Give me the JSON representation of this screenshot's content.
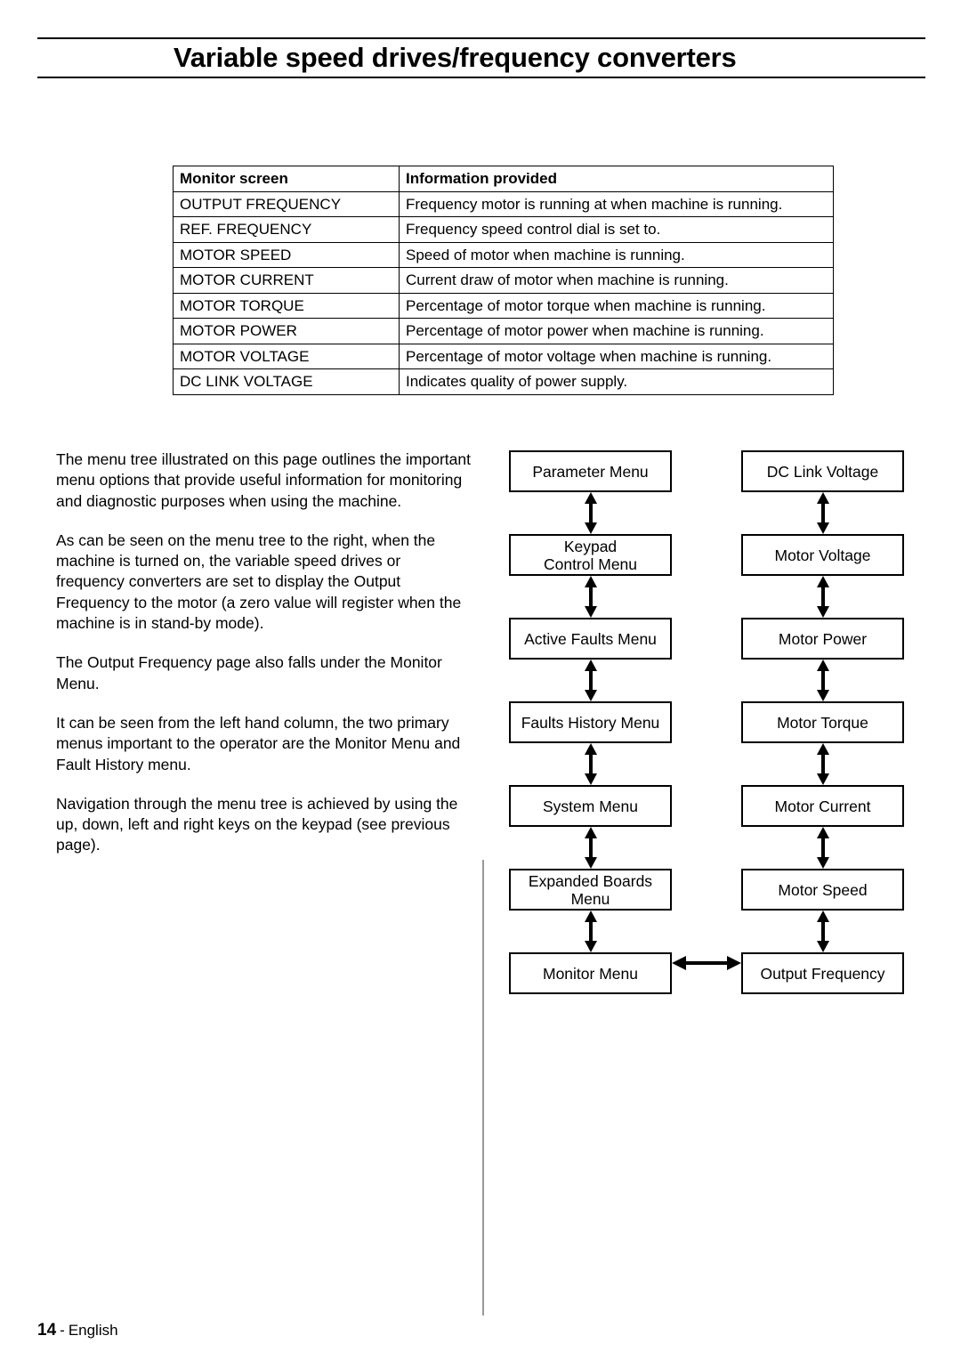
{
  "header": {
    "title": "Variable speed drives/frequency converters"
  },
  "table": {
    "columns": [
      "Monitor screen",
      "Information provided"
    ],
    "rows": [
      [
        "OUTPUT FREQUENCY",
        "Frequency motor is running at when machine is running."
      ],
      [
        "REF. FREQUENCY",
        "Frequency speed control dial is set to."
      ],
      [
        "MOTOR SPEED",
        "Speed of motor when machine is running."
      ],
      [
        "MOTOR CURRENT",
        "Current draw of motor when machine is running."
      ],
      [
        "MOTOR TORQUE",
        "Percentage of motor torque when machine is running."
      ],
      [
        "MOTOR POWER",
        "Percentage of motor power when machine is running."
      ],
      [
        "MOTOR VOLTAGE",
        "Percentage of motor voltage when machine is running."
      ],
      [
        "DC LINK VOLTAGE",
        "Indicates quality of power supply."
      ]
    ]
  },
  "body": {
    "paragraphs": [
      "The menu tree illustrated on this page outlines the important menu options that provide useful information for monitoring and diagnostic purposes when using the machine.",
      "As can be seen on the menu tree to the right, when the machine is turned on, the variable speed drives or frequency converters are set to display the Output Frequency to the motor (a zero value will register when the machine is in stand-by mode).",
      "The Output Frequency page also falls under the Monitor Menu.",
      "It can be seen from the left hand column, the two primary menus important to the operator are the Monitor Menu and Fault History menu.",
      "Navigation through the menu tree is achieved by using the up, down, left and right keys on the keypad (see previous page)."
    ]
  },
  "menu_tree": {
    "left_column": [
      "Parameter Menu",
      "Keypad\nControl Menu",
      "Active Faults Menu",
      "Faults History Menu",
      "System Menu",
      "Expanded Boards\nMenu",
      "Monitor Menu"
    ],
    "right_column": [
      "DC Link Voltage",
      "Motor Voltage",
      "Motor Power",
      "Motor Torque",
      "Motor Current",
      "Motor Speed",
      "Output Frequency"
    ]
  },
  "footer": {
    "page_number": "14",
    "separator": "-",
    "language": "English"
  },
  "colors": {
    "ink": "#000000",
    "paper": "#ffffff",
    "divider": "#9a9a9a"
  }
}
